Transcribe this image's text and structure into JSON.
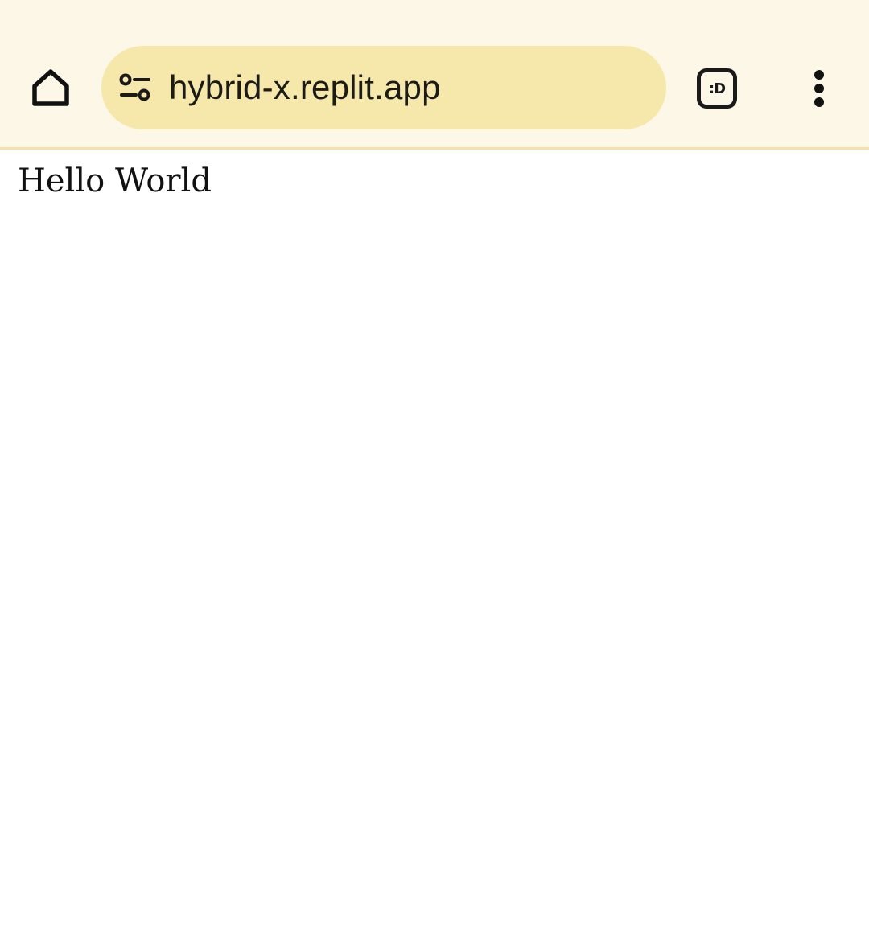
{
  "browser": {
    "url": "hybrid-x.replit.app",
    "tab_switch_label": ":D",
    "icons": {
      "home": "home-icon",
      "site_info": "tune-icon",
      "menu": "more-vert-icon"
    },
    "colors": {
      "toolbar_bg": "#fdf7e8",
      "url_bar_bg": "#f6e8aa",
      "divider": "#f3e3a6"
    }
  },
  "page": {
    "text": "Hello World"
  }
}
